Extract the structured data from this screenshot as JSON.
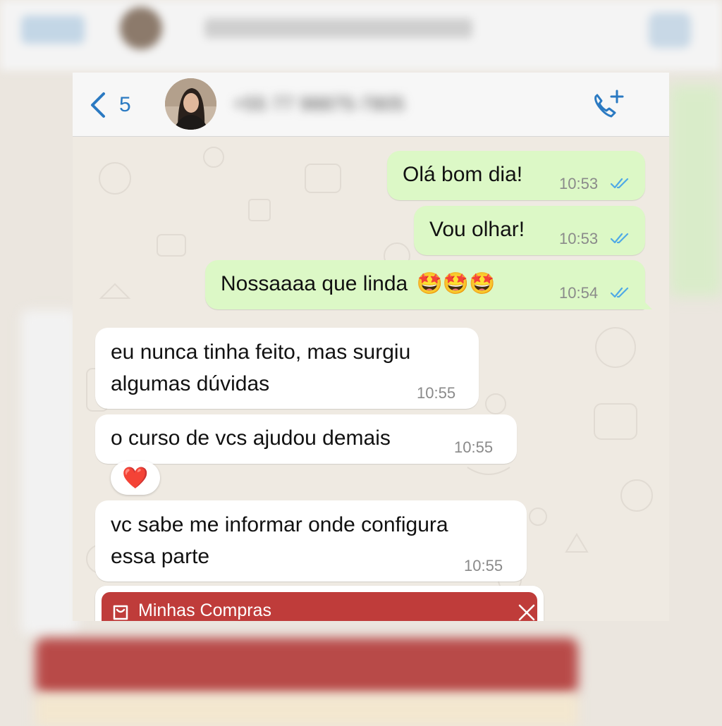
{
  "header": {
    "back_count": "5",
    "contact_name": "+55 77 98875-7805"
  },
  "messages": [
    {
      "direction": "out",
      "text": "Olá bom dia!",
      "time": "10:53",
      "status": "read"
    },
    {
      "direction": "out",
      "text": "Vou olhar!",
      "time": "10:53",
      "status": "read"
    },
    {
      "direction": "out",
      "text": "Nossaaaa que linda",
      "emoji": "🤩🤩🤩",
      "time": "10:54",
      "status": "read"
    },
    {
      "direction": "in",
      "line1": "eu nunca tinha feito, mas surgiu",
      "line2": "algumas dúvidas",
      "time": "10:55"
    },
    {
      "direction": "in",
      "text": "o curso de vcs ajudou demais",
      "time": "10:55",
      "reaction": "❤️"
    },
    {
      "direction": "in",
      "line1": "vc sabe me informar onde configura",
      "line2": "essa parte",
      "time": "10:55"
    }
  ],
  "attachment_card": {
    "title": "Minhas Compras"
  },
  "colors": {
    "outgoing_bubble": "#dcf8c6",
    "incoming_bubble": "#ffffff",
    "accent_blue": "#2b7ac2",
    "read_ticks": "#4fa9e6",
    "card_red": "#bf3c3a"
  },
  "icons": [
    "chevron-left-icon",
    "phone-add-icon",
    "double-check-icon",
    "star-struck-emoji-icon",
    "heart-icon",
    "shopping-bag-icon",
    "close-icon"
  ]
}
